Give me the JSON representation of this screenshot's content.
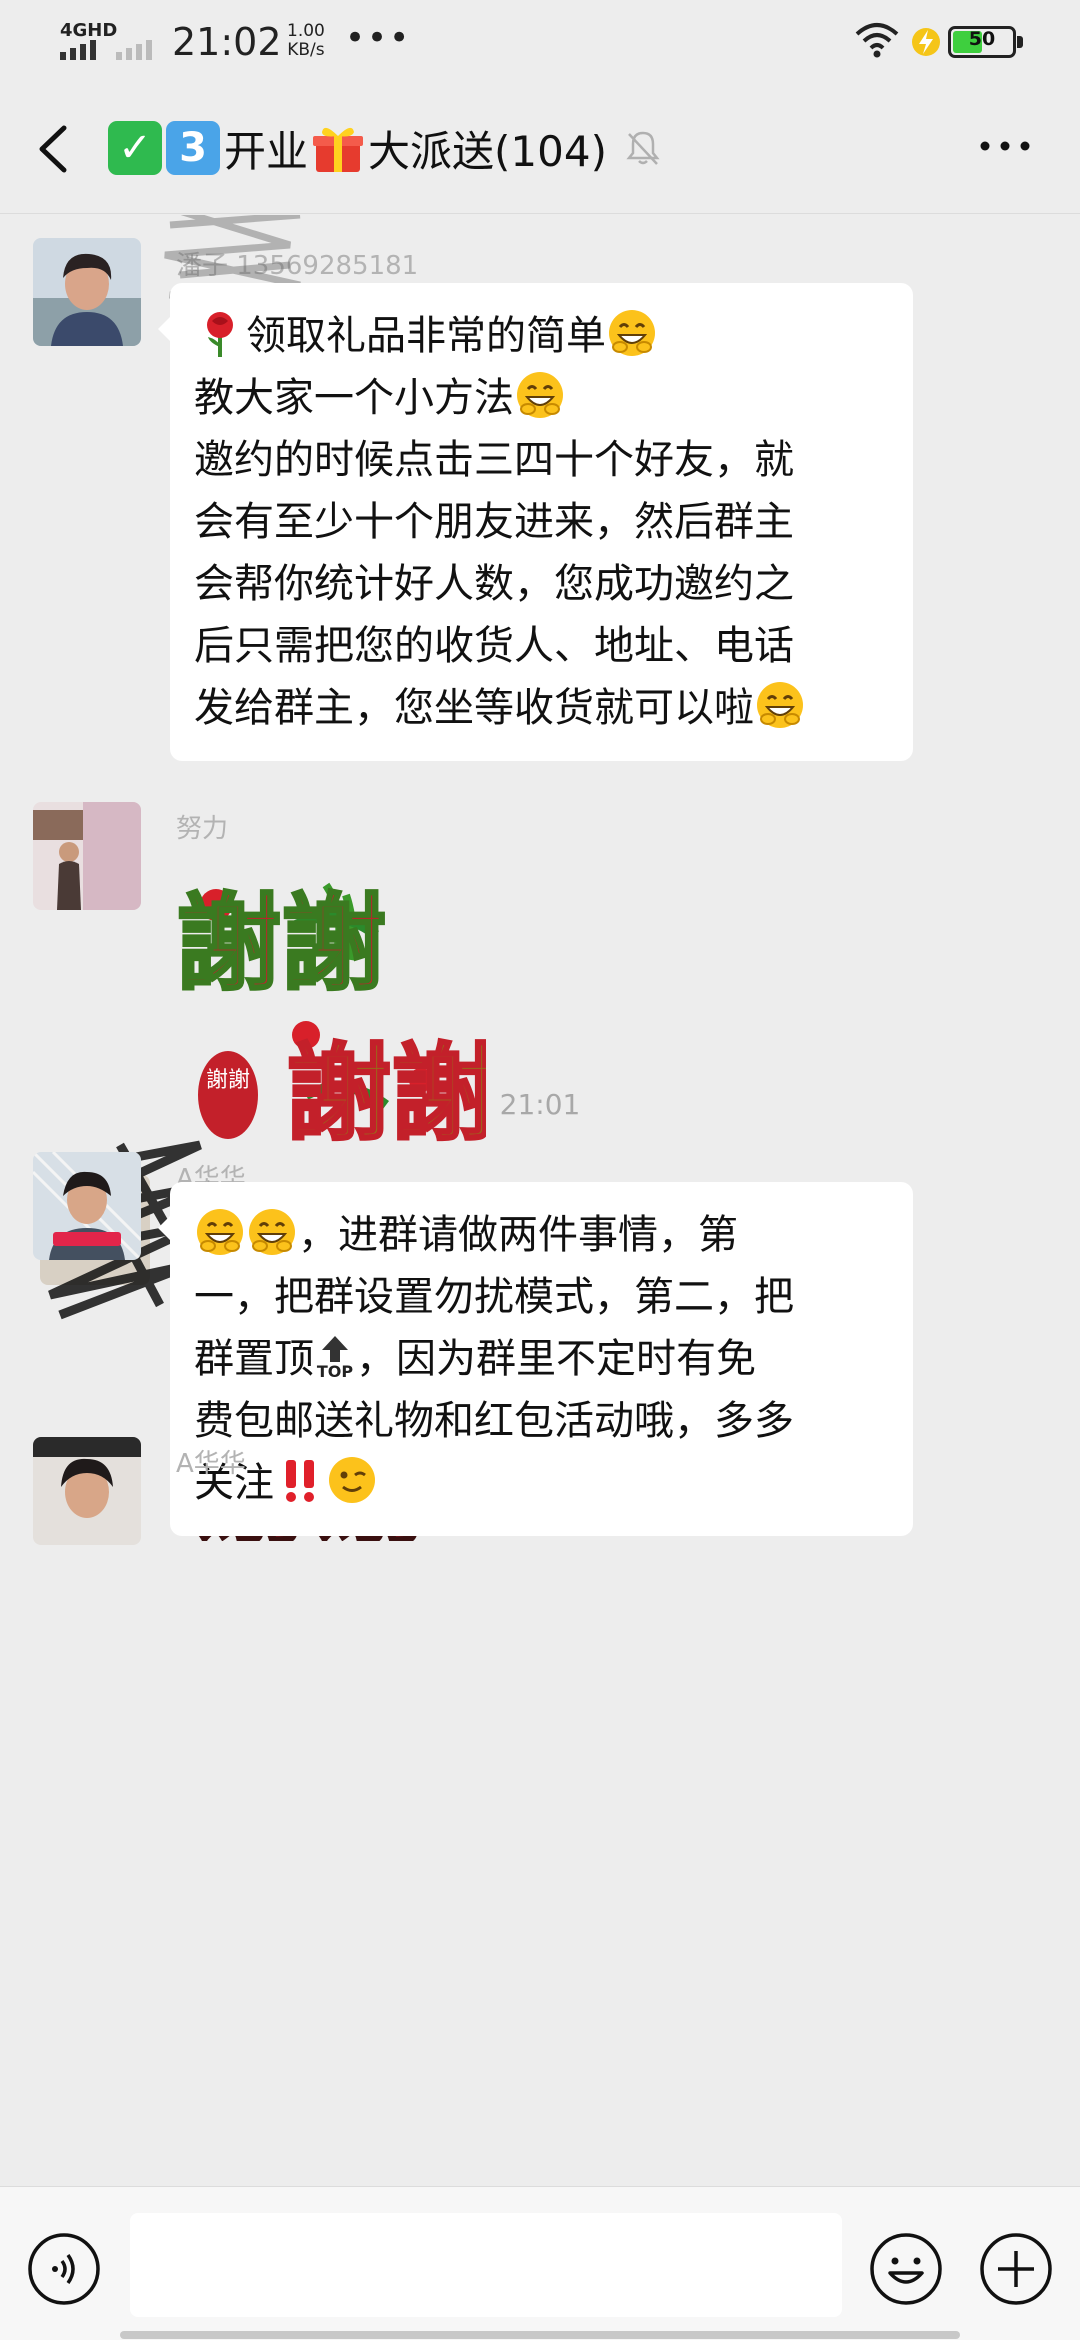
{
  "status_bar": {
    "network": "4GHD",
    "time": "21:02",
    "speed_value": "1.00",
    "speed_unit": "KB/s",
    "dots": "•••",
    "battery_level": "50",
    "battery_fraction": 0.5,
    "icons": [
      "signal-icon",
      "wifi-icon",
      "charging-icon",
      "battery-icon"
    ]
  },
  "nav": {
    "back_icon": "chevron-left-icon",
    "title_check": "✓",
    "title_three": "3",
    "title_part1": "开业",
    "title_part2": "大派送(104)",
    "mute_icon": "bell-off-icon",
    "more_icon": "more-dots-icon"
  },
  "messages": [
    {
      "sender": "潘子 13569285181",
      "lines": [
        "领取礼品非常的简单",
        "教大家一个小方法",
        "邀约的时候点击三四十个好友，就",
        "会有至少十个朋友进来，然后群主",
        "会帮你统计好人数，您成功邀约之",
        "后只需把您的收货人、地址、电话",
        "发给群主，您坐等收货就可以啦"
      ]
    },
    {
      "sender": "努力",
      "sticker_text": "謝謝",
      "sticker_seal": "謝謝"
    },
    {
      "sender": "",
      "sticker_text": "谢谢"
    },
    {
      "sender": "A华华",
      "lines": [
        "，进群请做两件事情，第",
        "一，把群设置勿扰模式，第二，把",
        "群置顶",
        "，因为群里不定时有免",
        "费包邮送礼物和红包活动哦，多多",
        "关注"
      ],
      "top_label": "TOP"
    },
    {
      "sender": "A华华"
    }
  ],
  "timestamp": "21:01",
  "input_bar": {
    "placeholder": "",
    "voice_icon": "voice-icon",
    "emoji_icon": "emoji-icon",
    "plus_icon": "plus-icon"
  }
}
